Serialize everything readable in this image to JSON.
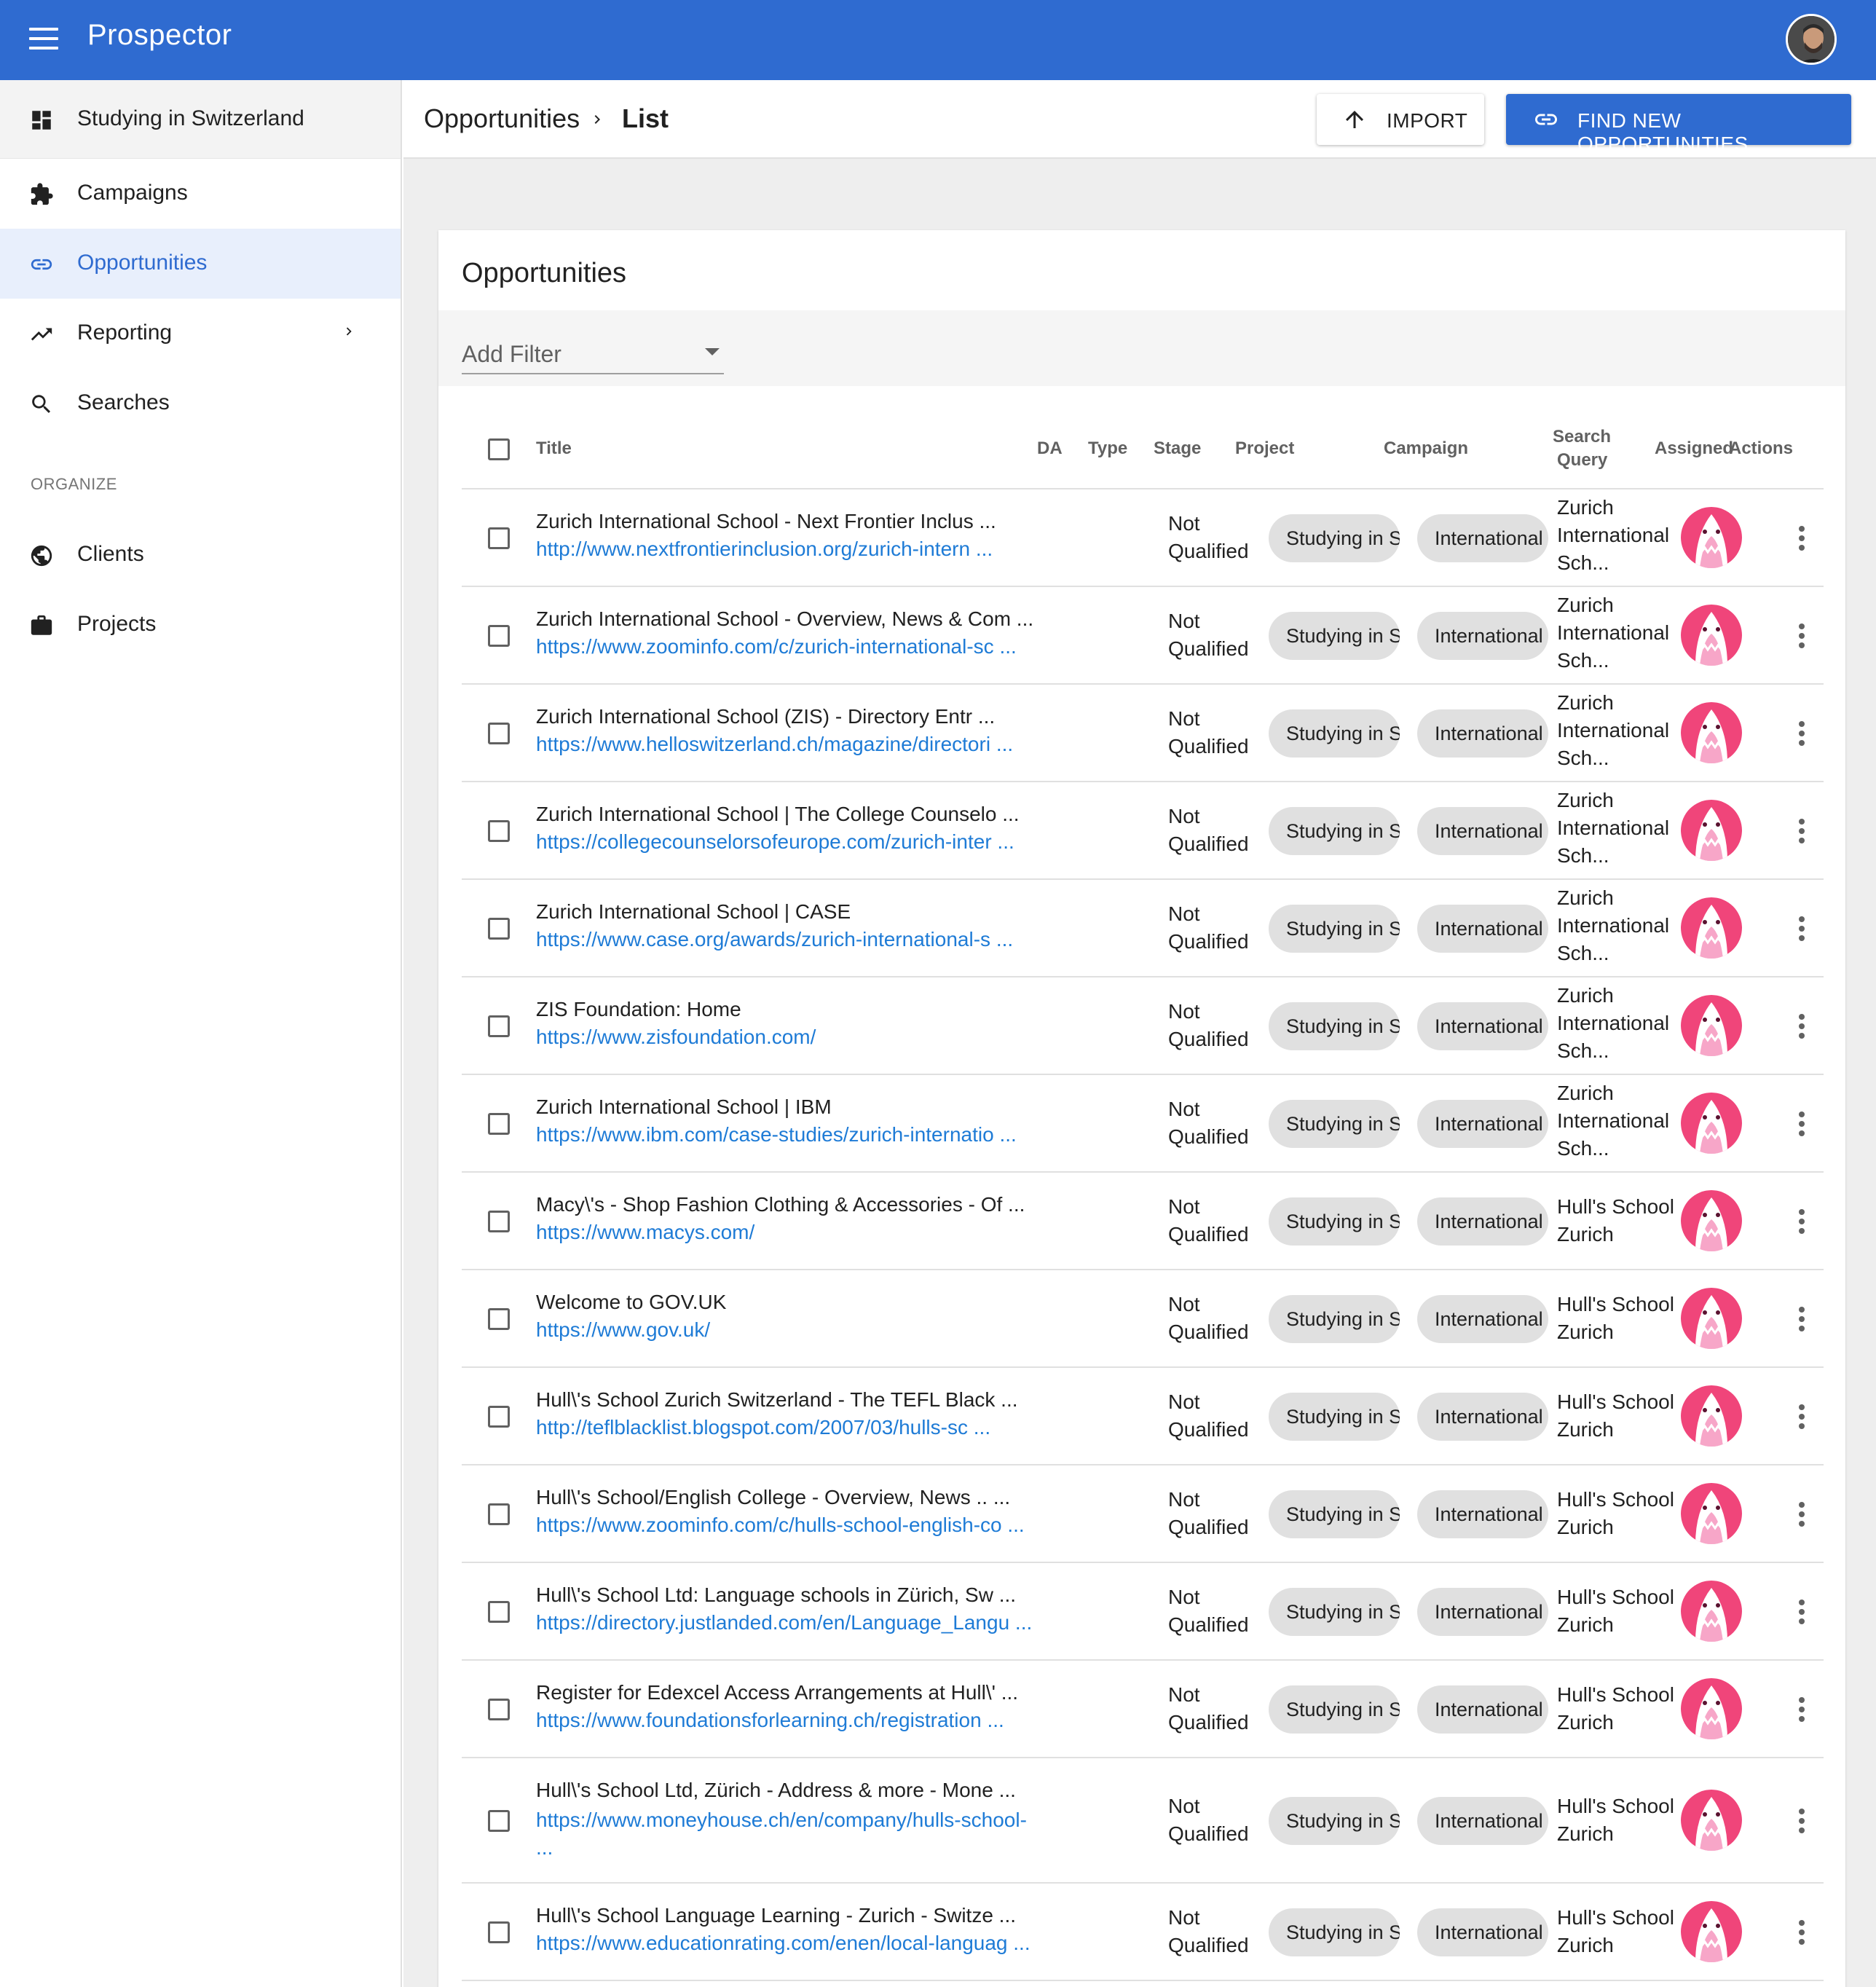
{
  "app": {
    "title": "Prospector"
  },
  "sidebar": {
    "project": "Studying in Switzerland",
    "items": [
      {
        "label": "Campaigns",
        "icon": "puzzle-icon"
      },
      {
        "label": "Opportunities",
        "icon": "link-icon",
        "active": true
      },
      {
        "label": "Reporting",
        "icon": "trending-up-icon"
      },
      {
        "label": "Searches",
        "icon": "search-icon"
      }
    ],
    "section_label": "ORGANIZE",
    "organize": [
      {
        "label": "Clients",
        "icon": "globe-icon"
      },
      {
        "label": "Projects",
        "icon": "briefcase-icon"
      }
    ]
  },
  "header": {
    "breadcrumb": [
      "Opportunities",
      "List"
    ],
    "import_label": "IMPORT",
    "find_label": "FIND NEW OPPORTUNITIES"
  },
  "card": {
    "title": "Opportunities",
    "filter_placeholder": "Add Filter"
  },
  "table": {
    "columns": {
      "title": "Title",
      "da": "DA",
      "type": "Type",
      "stage": "Stage",
      "project": "Project",
      "campaign": "Campaign",
      "search_query_1": "Search",
      "search_query_2": "Query",
      "assigned": "Assigned",
      "actions": "Actions"
    },
    "rows": [
      {
        "title": "Zurich International School - Next Frontier Inclus ...",
        "url": "http://www.nextfrontierinclusion.org/zurich-intern ...",
        "stage_1": "Not",
        "stage_2": "Qualified",
        "project": "Studying in Switzerland",
        "campaign": "International Schools",
        "sq_1": "Zurich",
        "sq_2": "International",
        "sq_3": "Sch..."
      },
      {
        "title": "Zurich International School - Overview, News & Com ...",
        "url": "https://www.zoominfo.com/c/zurich-international-sc ...",
        "stage_1": "Not",
        "stage_2": "Qualified",
        "project": "Studying in Switzerland",
        "campaign": "International Schools",
        "sq_1": "Zurich",
        "sq_2": "International",
        "sq_3": "Sch..."
      },
      {
        "title": "Zurich International School (ZIS) - Directory Entr ...",
        "url": "https://www.helloswitzerland.ch/magazine/directori ...",
        "stage_1": "Not",
        "stage_2": "Qualified",
        "project": "Studying in Switzerland",
        "campaign": "International Schools",
        "sq_1": "Zurich",
        "sq_2": "International",
        "sq_3": "Sch..."
      },
      {
        "title": "Zurich International School | The College Counselo ...",
        "url": "https://collegecounselorsofeurope.com/zurich-inter ...",
        "stage_1": "Not",
        "stage_2": "Qualified",
        "project": "Studying in Switzerland",
        "campaign": "International Schools",
        "sq_1": "Zurich",
        "sq_2": "International",
        "sq_3": "Sch..."
      },
      {
        "title": "Zurich International School | CASE",
        "url": "https://www.case.org/awards/zurich-international-s ...",
        "stage_1": "Not",
        "stage_2": "Qualified",
        "project": "Studying in Switzerland",
        "campaign": "International Schools",
        "sq_1": "Zurich",
        "sq_2": "International",
        "sq_3": "Sch..."
      },
      {
        "title": "ZIS Foundation: Home",
        "url": "https://www.zisfoundation.com/",
        "stage_1": "Not",
        "stage_2": "Qualified",
        "project": "Studying in Switzerland",
        "campaign": "International Schools",
        "sq_1": "Zurich",
        "sq_2": "International",
        "sq_3": "Sch..."
      },
      {
        "title": "Zurich International School | IBM",
        "url": "https://www.ibm.com/case-studies/zurich-internatio ...",
        "stage_1": "Not",
        "stage_2": "Qualified",
        "project": "Studying in Switzerland",
        "campaign": "International Schools",
        "sq_1": "Zurich",
        "sq_2": "International",
        "sq_3": "Sch..."
      },
      {
        "title": "Macy\\'s - Shop Fashion Clothing & Accessories - Of ...",
        "url": "https://www.macys.com/",
        "stage_1": "Not",
        "stage_2": "Qualified",
        "project": "Studying in Switzerland",
        "campaign": "International Schools",
        "sq_1": "Hull's School",
        "sq_2": "Zurich",
        "sq_3": ""
      },
      {
        "title": "Welcome to GOV.UK",
        "url": "https://www.gov.uk/",
        "stage_1": "Not",
        "stage_2": "Qualified",
        "project": "Studying in Switzerland",
        "campaign": "International Schools",
        "sq_1": "Hull's School",
        "sq_2": "Zurich",
        "sq_3": ""
      },
      {
        "title": "Hull\\'s School Zurich Switzerland - The TEFL Black ...",
        "url": "http://teflblacklist.blogspot.com/2007/03/hulls-sc ...",
        "stage_1": "Not",
        "stage_2": "Qualified",
        "project": "Studying in Switzerland",
        "campaign": "International Schools",
        "sq_1": "Hull's School",
        "sq_2": "Zurich",
        "sq_3": ""
      },
      {
        "title": "Hull\\'s School/English College - Overview, News .. ...",
        "url": "https://www.zoominfo.com/c/hulls-school-english-co ...",
        "stage_1": "Not",
        "stage_2": "Qualified",
        "project": "Studying in Switzerland",
        "campaign": "International Schools",
        "sq_1": "Hull's School",
        "sq_2": "Zurich",
        "sq_3": ""
      },
      {
        "title": "Hull\\'s School Ltd: Language schools in Zürich, Sw ...",
        "url": "https://directory.justlanded.com/en/Language_Langu ...",
        "stage_1": "Not",
        "stage_2": "Qualified",
        "project": "Studying in Switzerland",
        "campaign": "International Schools",
        "sq_1": "Hull's School",
        "sq_2": "Zurich",
        "sq_3": ""
      },
      {
        "title": "Register for Edexcel Access Arrangements at Hull\\' ...",
        "url": "https://www.foundationsforlearning.ch/registration ...",
        "stage_1": "Not",
        "stage_2": "Qualified",
        "project": "Studying in Switzerland",
        "campaign": "International Schools",
        "sq_1": "Hull's School",
        "sq_2": "Zurich",
        "sq_3": ""
      },
      {
        "title": "Hull\\'s School Ltd, Zürich - Address & more - Mone ...",
        "url": "https://www.moneyhouse.ch/en/company/hulls-school- ...",
        "stage_1": "Not",
        "stage_2": "Qualified",
        "project": "Studying in Switzerland",
        "campaign": "International Schools",
        "sq_1": "Hull's School",
        "sq_2": "Zurich",
        "sq_3": "",
        "tall": true
      },
      {
        "title": "Hull\\'s School Language Learning - Zurich - Switze ...",
        "url": "https://www.educationrating.com/enen/local-languag ...",
        "stage_1": "Not",
        "stage_2": "Qualified",
        "project": "Studying in Switzerland",
        "campaign": "International Schools",
        "sq_1": "Hull's School",
        "sq_2": "Zurich",
        "sq_3": ""
      }
    ]
  },
  "colors": {
    "primary": "#2f6bd0",
    "link": "#1e7bd6",
    "chip": "#e0e0e0",
    "avatar_pink": "#f0457a"
  }
}
